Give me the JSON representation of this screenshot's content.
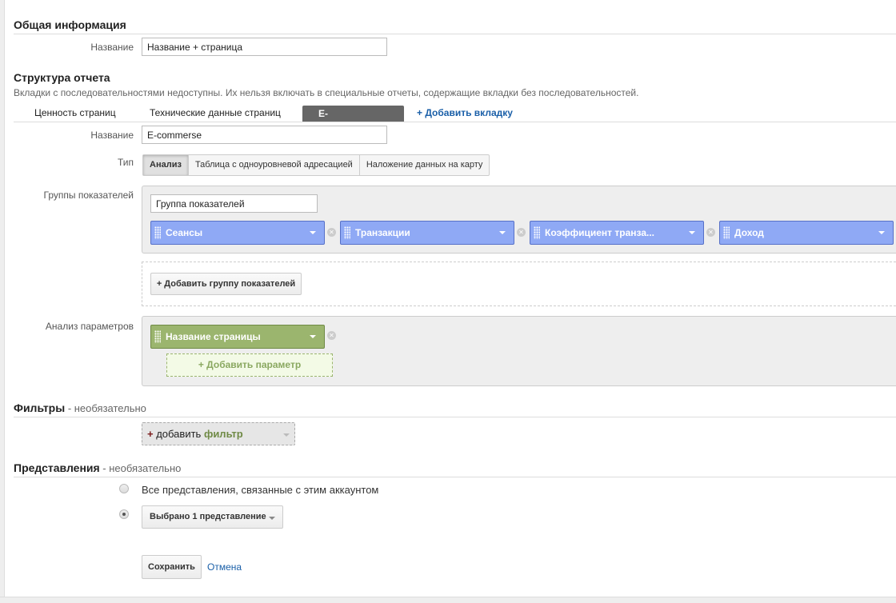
{
  "general": {
    "heading": "Общая информация",
    "name_label": "Название",
    "name_value": "Название + страница"
  },
  "structure": {
    "heading": "Структура отчета",
    "note": "Вкладки с последовательностями недоступны. Их нельзя включать в специальные отчеты, содержащие вкладки без последовательностей.",
    "tabs": [
      "Ценность страниц",
      "Технические данные страниц",
      "E-commerse"
    ],
    "close_icon": "×",
    "add_tab": "+ Добавить вкладку",
    "name_label": "Название",
    "name_value": "E-commerse",
    "type_label": "Тип",
    "types": [
      "Анализ",
      "Таблица с одноуровневой адресацией",
      "Наложение данных на карту"
    ],
    "metric_groups_label": "Группы показателей",
    "group_name": "Группа показателей",
    "metrics": [
      "Сеансы",
      "Транзакции",
      "Коэффициент транза...",
      "Доход"
    ],
    "add_group": "+ Добавить группу показателей",
    "dimensions_label": "Анализ параметров",
    "dimensions": [
      "Название страницы"
    ],
    "add_dimension": "+ Добавить параметр"
  },
  "filters": {
    "heading": "Фильтры",
    "optional": " - необязательно",
    "add_plus": "+",
    "add_text": "добавить",
    "add_bold": "фильтр"
  },
  "views": {
    "heading": "Представления",
    "optional": " - необязательно",
    "all_views": "Все представления, связанные с этим аккаунтом",
    "selected": "Выбрано 1 представление"
  },
  "actions": {
    "save": "Сохранить",
    "cancel": "Отмена"
  },
  "colors": {
    "metric": "#8fa9f5",
    "dimension": "#9bb56e",
    "link": "#1a5fa8"
  }
}
